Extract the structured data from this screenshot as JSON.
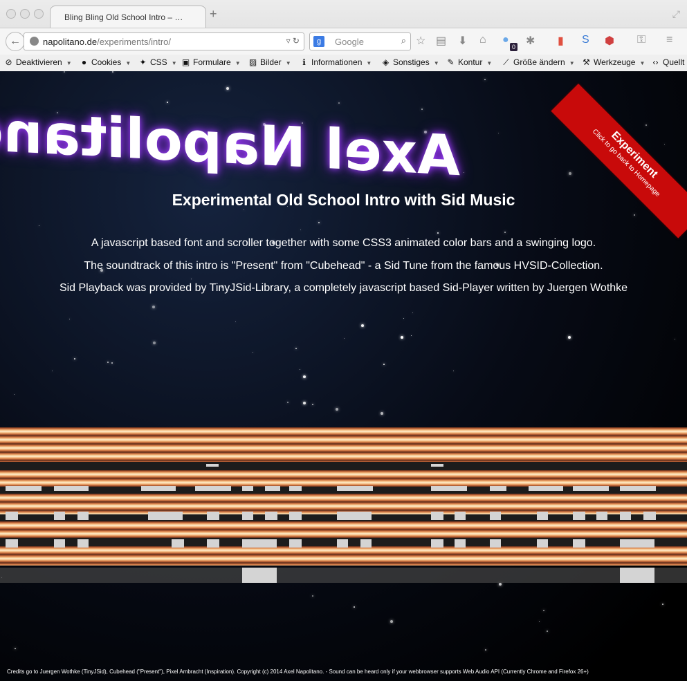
{
  "browser": {
    "tab_title": "Bling Bling Old School Intro – …",
    "new_tab": "+",
    "url_host": "napolitano.de",
    "url_path": "/experiments/intro/",
    "search_placeholder": "Google",
    "badge_count": "0"
  },
  "bookmarks": [
    {
      "label": "Deaktivieren",
      "icon": "no-entry-icon"
    },
    {
      "label": "Cookies",
      "icon": "person-icon"
    },
    {
      "label": "CSS",
      "icon": "magic-wand-icon"
    },
    {
      "label": "Formulare",
      "icon": "clipboard-icon"
    },
    {
      "label": "Bilder",
      "icon": "image-icon"
    },
    {
      "label": "Informationen",
      "icon": "info-icon"
    },
    {
      "label": "Sonstiges",
      "icon": "cube-icon"
    },
    {
      "label": "Kontur",
      "icon": "pencil-icon"
    },
    {
      "label": "Größe ändern",
      "icon": "ruler-icon"
    },
    {
      "label": "Werkzeuge",
      "icon": "wrench-icon"
    },
    {
      "label": "Quellt",
      "icon": "code-icon"
    }
  ],
  "page": {
    "logo_text": "Axel Napolitano",
    "ribbon_title": "Experiment",
    "ribbon_subtitle": "Click to go back to Homepage",
    "headline": "Experimental Old School Intro with Sid Music",
    "desc_1": "A javascript based font and scroller together with some CSS3 animated color bars and a swinging logo.",
    "desc_2": "The soundtrack of this intro is \"Present\" from \"Cubehead\" - a Sid Tune from the famous HVSID-Collection.",
    "desc_3": "Sid Playback was provided by TinyJSid-Library, a completely javascript based Sid-Player written by Juergen Wothke",
    "credits": "Credits go to Juergen Wothke (TinyJSid), Cubehead (\"Present\"), Pixel Ambracht (Inspiration). Copyright (c) 2014 Axel Napolitano. - Sound can be heard only if your webbrowser supports Web Audio API (Currently Chrome and Firefox 26+)"
  },
  "colors": {
    "ribbon": "#c80a0a",
    "logo_glow": "#a040ff"
  }
}
